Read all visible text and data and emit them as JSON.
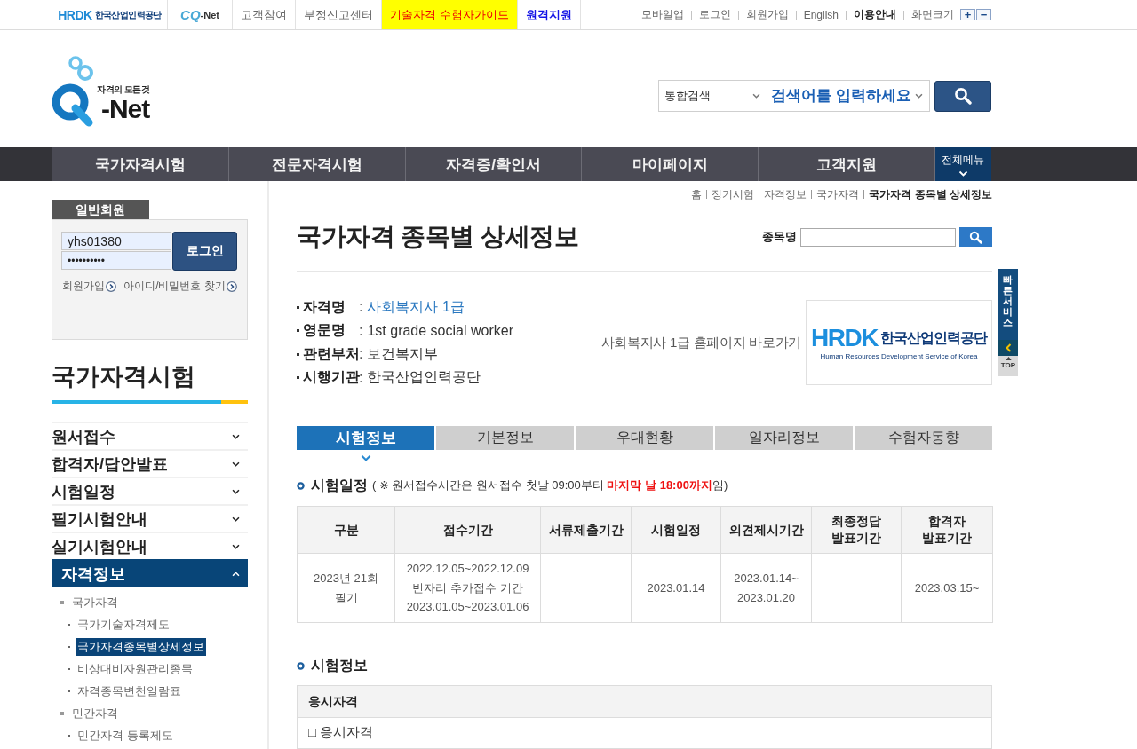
{
  "top_bar": {
    "family_sites": [
      {
        "kind": "hrdk",
        "mark": "HRDK",
        "name": "한국산업인력공단"
      },
      {
        "kind": "cqnet",
        "mark": "CQ",
        "name": "-Net"
      }
    ],
    "links": [
      {
        "label": "고객참여",
        "kind": "plain"
      },
      {
        "label": "부정신고센터",
        "kind": "plain"
      },
      {
        "label": "기술자격 수험자가이드",
        "kind": "highlight"
      },
      {
        "label": "원격지원",
        "kind": "emphasis"
      }
    ],
    "utility_links": [
      {
        "label": "모바일앱",
        "bold": false
      },
      {
        "label": "로그인",
        "bold": false
      },
      {
        "label": "회원가입",
        "bold": false
      },
      {
        "label": "English",
        "bold": false
      },
      {
        "label": "이용안내",
        "bold": true
      }
    ],
    "font_size": {
      "label": "화면크기",
      "buttons": [
        "+",
        "−"
      ]
    }
  },
  "header": {
    "logo": {
      "tagline": "자격의 모든것",
      "name": "-Net"
    },
    "search": {
      "scope": "통합검색",
      "placeholder": "검색어를 입력하세요"
    }
  },
  "main_nav": {
    "items": [
      "국가자격시험",
      "전문자격시험",
      "자격증/확인서",
      "마이페이지",
      "고객지원"
    ],
    "all_menu": "전체메뉴"
  },
  "sidebar": {
    "login": {
      "tab": "일반회원",
      "user_id": "yhs01380",
      "password": "••••••••••",
      "button": "로그인",
      "links": [
        "회원가입",
        "아이디/비밀번호 찾기"
      ]
    },
    "title": "국가자격시험",
    "menu": [
      {
        "label": "원서접수",
        "expanded": false
      },
      {
        "label": "합격자/답안발표",
        "expanded": false
      },
      {
        "label": "시험일정",
        "expanded": false
      },
      {
        "label": "필기시험안내",
        "expanded": false
      },
      {
        "label": "실기시험안내",
        "expanded": false
      },
      {
        "label": "자격정보",
        "expanded": true,
        "children": [
          {
            "label": "국가자격",
            "selected": false,
            "children": [
              {
                "label": "국가기술자격제도",
                "selected": false
              },
              {
                "label": "국가자격종목별상세정보",
                "selected": true
              },
              {
                "label": "비상대비자원관리종목",
                "selected": false
              },
              {
                "label": "자격종목변천일람표",
                "selected": false
              }
            ]
          },
          {
            "label": "민간자격",
            "selected": false,
            "children": [
              {
                "label": "민간자격 등록제도",
                "selected": false
              }
            ]
          }
        ]
      }
    ]
  },
  "breadcrumb": [
    "홈",
    "정기시험",
    "자격정보",
    "국가자격",
    "국가자격 종목별 상세정보"
  ],
  "page": {
    "title": "국가자격 종목별 상세정보",
    "search": {
      "label": "종목명"
    }
  },
  "qualification": {
    "fields": [
      {
        "label": "자격명",
        "separator": ":",
        "value": "사회복지사 1급",
        "kind": "link"
      },
      {
        "label": "영문명",
        "separator": ":",
        "value": "1st grade social worker",
        "kind": "text"
      },
      {
        "label": "관련부처",
        "separator": ":",
        "value": "보건복지부",
        "kind": "text"
      },
      {
        "label": "시행기관",
        "separator": ":",
        "value": "한국산업인력공단",
        "kind": "text"
      }
    ],
    "homepage_link": "사회복지사 1급 홈페이지 바로가기",
    "agency_logo": {
      "mark": "HRDK",
      "name": "한국산업인력공단",
      "subtitle": "Human Resources Development Service of Korea"
    }
  },
  "tabs": [
    {
      "label": "시험정보",
      "selected": true
    },
    {
      "label": "기본정보",
      "selected": false
    },
    {
      "label": "우대현황",
      "selected": false
    },
    {
      "label": "일자리정보",
      "selected": false
    },
    {
      "label": "수험자동향",
      "selected": false
    }
  ],
  "schedule": {
    "title": "시험일정",
    "note": "( ※ 원서접수시간은 원서접수 첫날 09:00부터 **마지막 날 18:00까지**임)",
    "columns": [
      "구분",
      "접수기간",
      "서류제출기간",
      "시험일정",
      "의견제시기간",
      "최종정답 발표기간",
      "합격자 발표기간"
    ],
    "rows": [
      {
        "cells": [
          [
            "2023년 21회",
            "필기"
          ],
          [
            "2022.12.05~2022.12.09",
            "빈자리 추가접수 기간",
            "2023.01.05~2023.01.06"
          ],
          null,
          [
            "2023.01.14"
          ],
          [
            "2023.01.14~",
            "2023.01.20"
          ],
          null,
          [
            "2023.03.15~"
          ]
        ]
      }
    ]
  },
  "exam_info": {
    "title": "시험정보",
    "header": "응시자격",
    "rows": [
      "□ 응시자격"
    ]
  },
  "quick_menu": {
    "title": "빠른서비스",
    "top": "TOP"
  }
}
